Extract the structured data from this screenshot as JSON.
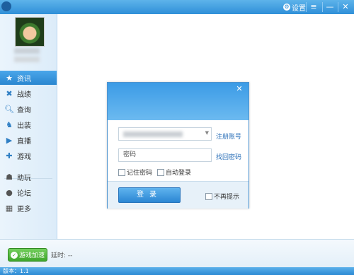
{
  "titlebar": {
    "title": "",
    "settings_label": "设置"
  },
  "sidebar": {
    "items": [
      {
        "label": "资讯",
        "icon": "star-icon"
      },
      {
        "label": "战绩",
        "icon": "record-icon"
      },
      {
        "label": "查询",
        "icon": "search-icon"
      },
      {
        "label": "出装",
        "icon": "equipment-icon"
      },
      {
        "label": "直播",
        "icon": "play-icon"
      },
      {
        "label": "游戏",
        "icon": "gamepad-icon"
      },
      {
        "label": "助玩",
        "icon": "helper-icon"
      },
      {
        "label": "论坛",
        "icon": "chat-bubble-icon"
      },
      {
        "label": "更多",
        "icon": "grid-icon"
      }
    ]
  },
  "bottom": {
    "accel_label": "游戏加速",
    "delay_label": "延时: --"
  },
  "statusbar": {
    "text": "版本：1.1"
  },
  "dialog": {
    "password_value": "密码",
    "register_link": "注册账号",
    "forgot_link": "找回密码",
    "remember_label": "记住密码",
    "autologin_label": "自动登录",
    "login_button": "登录",
    "no_prompt_label": "不再提示"
  },
  "colors": {
    "accent": "#2f8fd8",
    "accel_green": "#3ea62b",
    "link": "#2a6fb8"
  }
}
